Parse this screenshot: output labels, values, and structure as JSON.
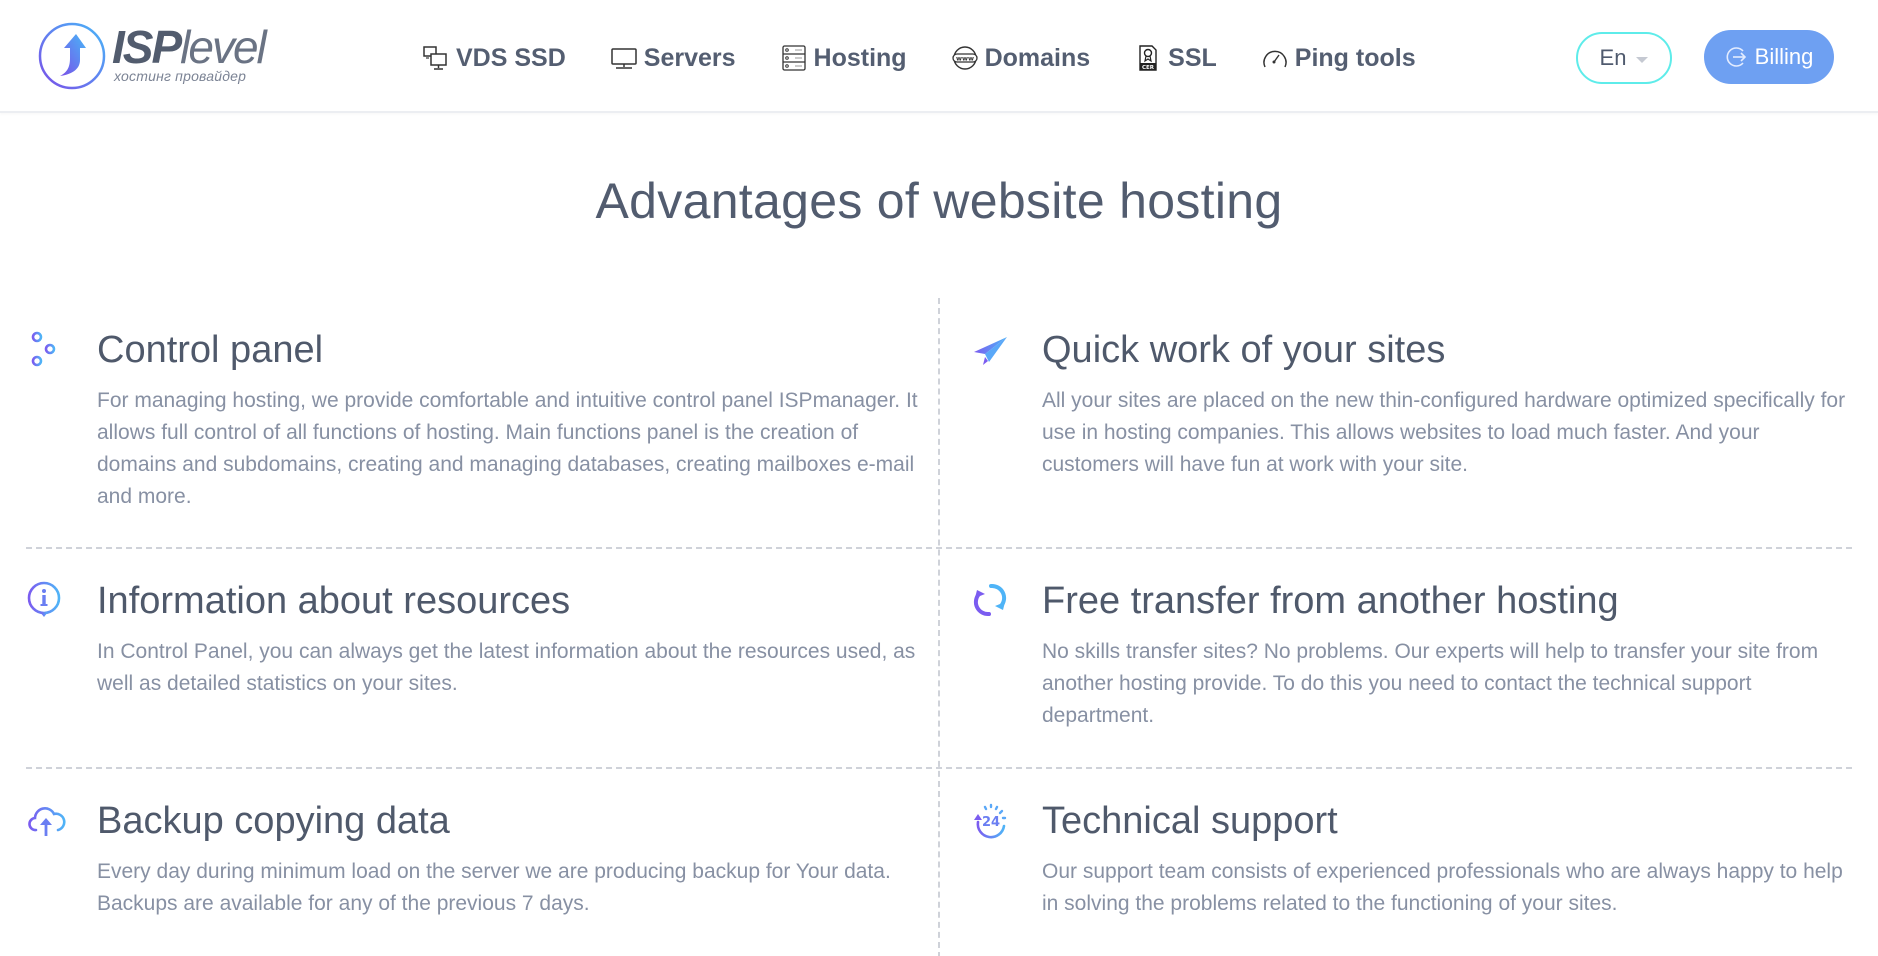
{
  "brand": {
    "name_bold": "ISP",
    "name_light": "level",
    "tagline": "хостинг провайдер"
  },
  "nav": {
    "items": [
      {
        "label": "VDS SSD",
        "icon": "vds-monitors-icon"
      },
      {
        "label": "Servers",
        "icon": "monitor-icon"
      },
      {
        "label": "Hosting",
        "icon": "server-rack-icon"
      },
      {
        "label": "Domains",
        "icon": "www-globe-icon"
      },
      {
        "label": "SSL",
        "icon": "certificate-icon"
      },
      {
        "label": "Ping tools",
        "icon": "speedometer-icon"
      }
    ]
  },
  "header": {
    "language": "En",
    "billing_label": "Billing"
  },
  "colors": {
    "accent_blue": "#6ea0f2",
    "accent_cyan": "#5eecea",
    "icon_gradient_start": "#7b5cf0",
    "icon_gradient_end": "#4fb4f7"
  },
  "main": {
    "title": "Advantages of website hosting",
    "features": [
      {
        "title": "Control panel",
        "icon": "sliders-icon",
        "description": "For managing hosting, we provide comfortable and intuitive control panel ISPmanager. It allows full control of all functions of hosting. Main functions panel is the creation of domains and subdomains, creating and managing databases, creating mailboxes e-mail and more."
      },
      {
        "title": "Quick work of your sites",
        "icon": "paper-plane-icon",
        "description": "All your sites are placed on the new thin-configured hardware optimized specifically for use in hosting companies. This allows websites to load much faster. And your customers will have fun at work with your site."
      },
      {
        "title": "Information about resources",
        "icon": "info-icon",
        "description": "In Control Panel, you can always get the latest information about the resources used, as well as detailed statistics on your sites."
      },
      {
        "title": "Free transfer from another hosting",
        "icon": "refresh-icon",
        "description": "No skills transfer sites? No problems. Our experts will help to transfer your site from another hosting provide. To do this you need to contact the technical support department."
      },
      {
        "title": "Backup copying data",
        "icon": "cloud-upload-icon",
        "description": "Every day during minimum load on the server we are producing backup for Your data. Backups are available for any of the previous 7 days."
      },
      {
        "title": "Technical support",
        "icon": "support-24-icon",
        "description": "Our support team consists of experienced professionals who are always happy to help in solving the problems related to the functioning of your sites."
      }
    ]
  }
}
